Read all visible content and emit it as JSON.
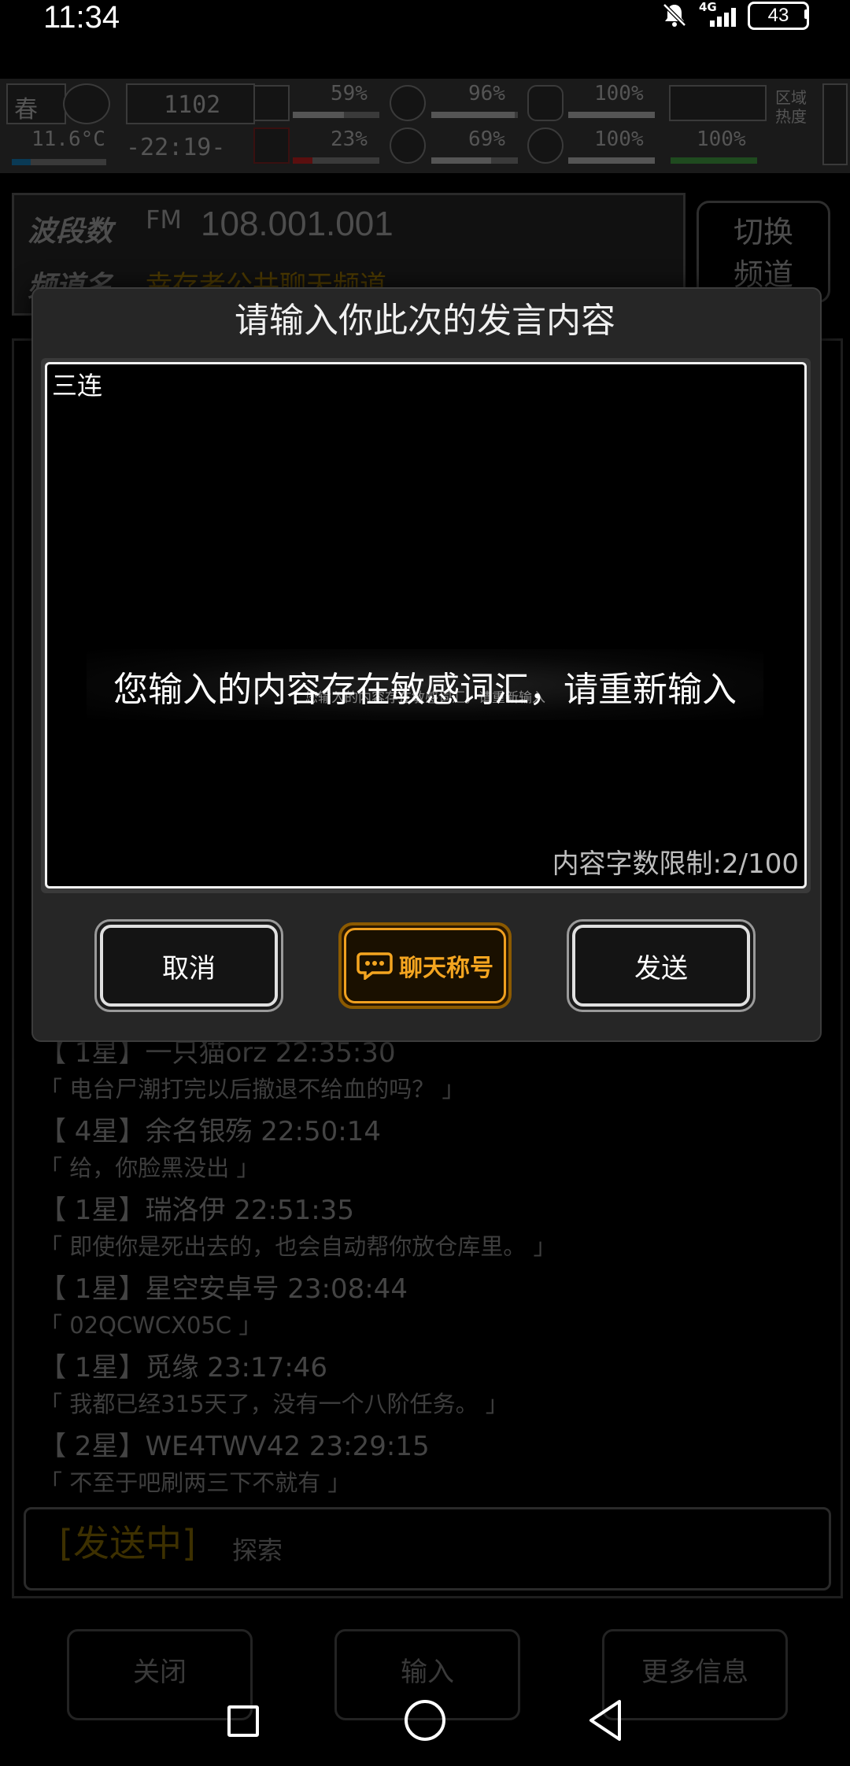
{
  "status_bar": {
    "time": "11:34",
    "network": "4G",
    "battery": "43"
  },
  "hud": {
    "season": "春",
    "temperature": "11.6°C",
    "day": "1102",
    "clock": "-22:19-",
    "stats": [
      {
        "value": "59%",
        "fill": 0.59
      },
      {
        "value": "96%",
        "fill": 0.96
      },
      {
        "value": "100%",
        "fill": 1.0
      },
      {
        "value": "23%",
        "fill": 0.23
      },
      {
        "value": "69%",
        "fill": 0.69
      },
      {
        "value": "100%",
        "fill": 1.0
      },
      {
        "value": "100%",
        "fill": 1.0
      }
    ],
    "area_heat_label": "区域热度"
  },
  "radio": {
    "band_label": "波段数",
    "fm_icon": "FM",
    "frequency": "108.001.001",
    "channel_label": "频道名",
    "channel_name": "幸存者公共聊天频道",
    "switch_button": "切换频道"
  },
  "chat_messages": [
    {
      "header": "【 1星】一只猫orz 22:35:30",
      "text": "「 电台尸潮打完以后撤退不给血的吗？ 」"
    },
    {
      "header": "【 4星】余名银殇 22:50:14",
      "text": "「 给，你脸黑没出 」"
    },
    {
      "header": "【 1星】瑞洛伊 22:51:35",
      "text": "「 即使你是死出去的，也会自动帮你放仓库里。 」"
    },
    {
      "header": "【 1星】星空安卓号 23:08:44",
      "text": "「 02QCWCX05C 」"
    },
    {
      "header": "【 1星】觅缘 23:17:46",
      "text": "「 我都已经315天了，没有一个八阶任务。 」"
    },
    {
      "header": "【 2星】WE4TWV42 23:29:15",
      "text": "「 不至于吧刷两三下不就有 」"
    }
  ],
  "send_bar": {
    "status": "[发送中]",
    "text": "探索"
  },
  "bottom_buttons": {
    "close": "关闭",
    "input": "输入",
    "more": "更多信息"
  },
  "dialog": {
    "title": "请输入你此次的发言内容",
    "input_value": "三连",
    "counter": "内容字数限制:2/100",
    "cancel": "取消",
    "nickname": "聊天称号",
    "send": "发送"
  },
  "toast": {
    "message": "您输入的内容存在敏感词汇，请重新输入",
    "message_small": "您输入的内容存在敏感词汇，请重新输入"
  },
  "colors": {
    "accent": "#f4a520",
    "dialog_bg": "#262626",
    "text": "#ffffff"
  }
}
